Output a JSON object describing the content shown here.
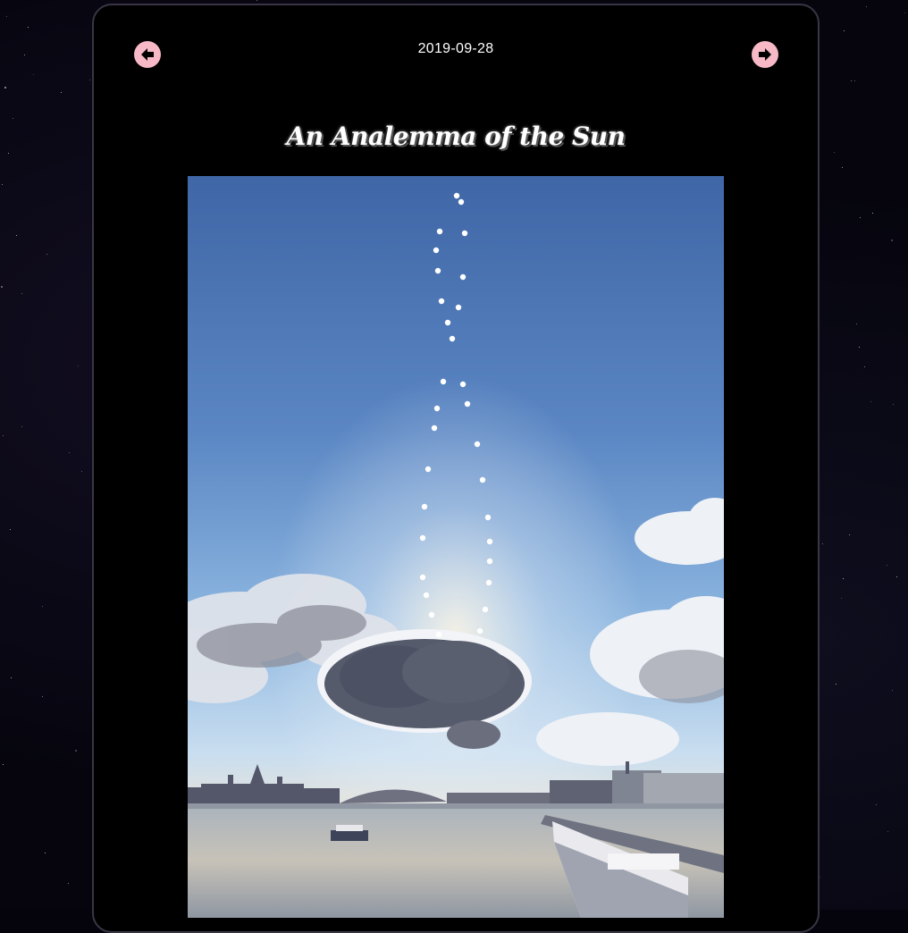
{
  "apod": {
    "date": "2019-09-28",
    "title": "An Analemma of the Sun"
  },
  "nav": {
    "prev_icon": "arrow-left-icon",
    "next_icon": "arrow-right-icon"
  },
  "colors": {
    "background": "#06050e",
    "card": "#000000",
    "card_border": "#3a3545",
    "nav_button": "#f7b9c6",
    "text": "#ffffff"
  }
}
